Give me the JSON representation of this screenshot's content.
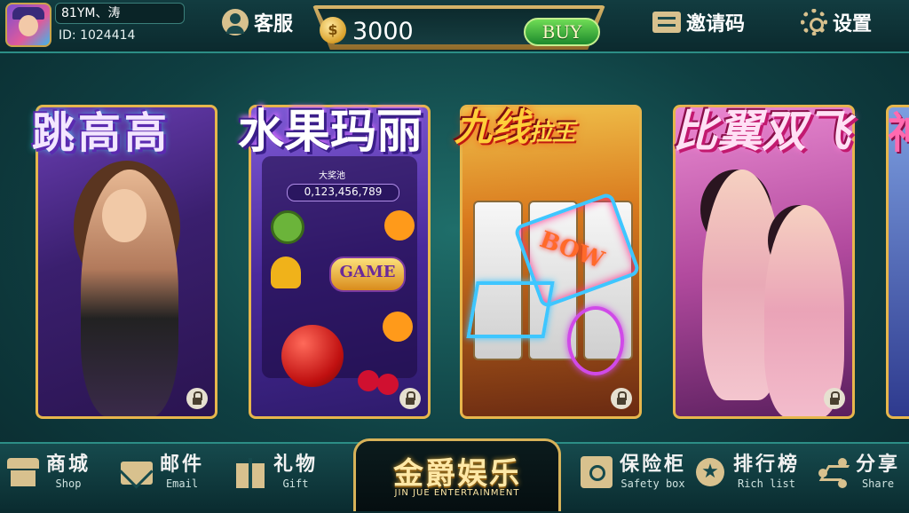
{
  "user": {
    "name": "81YM、涛",
    "id_label": "ID: 1024414"
  },
  "header": {
    "service_label": "客服",
    "coins": "3000",
    "buy_label": "BUY",
    "invite_label": "邀请码",
    "settings_label": "设置"
  },
  "games": [
    {
      "title": "跳高高"
    },
    {
      "title": "水果玛丽",
      "jackpot_label": "大奖池",
      "jackpot_value": "0,123,456,789",
      "badge": "GAME"
    },
    {
      "title": "九线",
      "title_small": "拉王",
      "neon_text": "BOW"
    },
    {
      "title": "比翼双飞"
    },
    {
      "title": "神"
    }
  ],
  "bottom_nav": [
    {
      "cn": "商城",
      "en": "Shop"
    },
    {
      "cn": "邮件",
      "en": "Email"
    },
    {
      "cn": "礼物",
      "en": "Gift"
    },
    {
      "cn": "保险柜",
      "en": "Safety box"
    },
    {
      "cn": "排行榜",
      "en": "Rich list"
    },
    {
      "cn": "分享",
      "en": "Share"
    }
  ],
  "logo": {
    "cn": "金爵娱乐",
    "en": "JIN JUE ENTERTAINMENT"
  },
  "colors": {
    "gold": "#d7b259",
    "teal": "#1f6e6a",
    "buy_green": "#1d8a2d"
  },
  "icons": [
    "user-service-icon",
    "coin-icon",
    "invite-code-icon",
    "gear-icon",
    "lock-icon",
    "shop-icon",
    "mail-icon",
    "gift-icon",
    "safe-icon",
    "rank-icon",
    "share-icon"
  ]
}
